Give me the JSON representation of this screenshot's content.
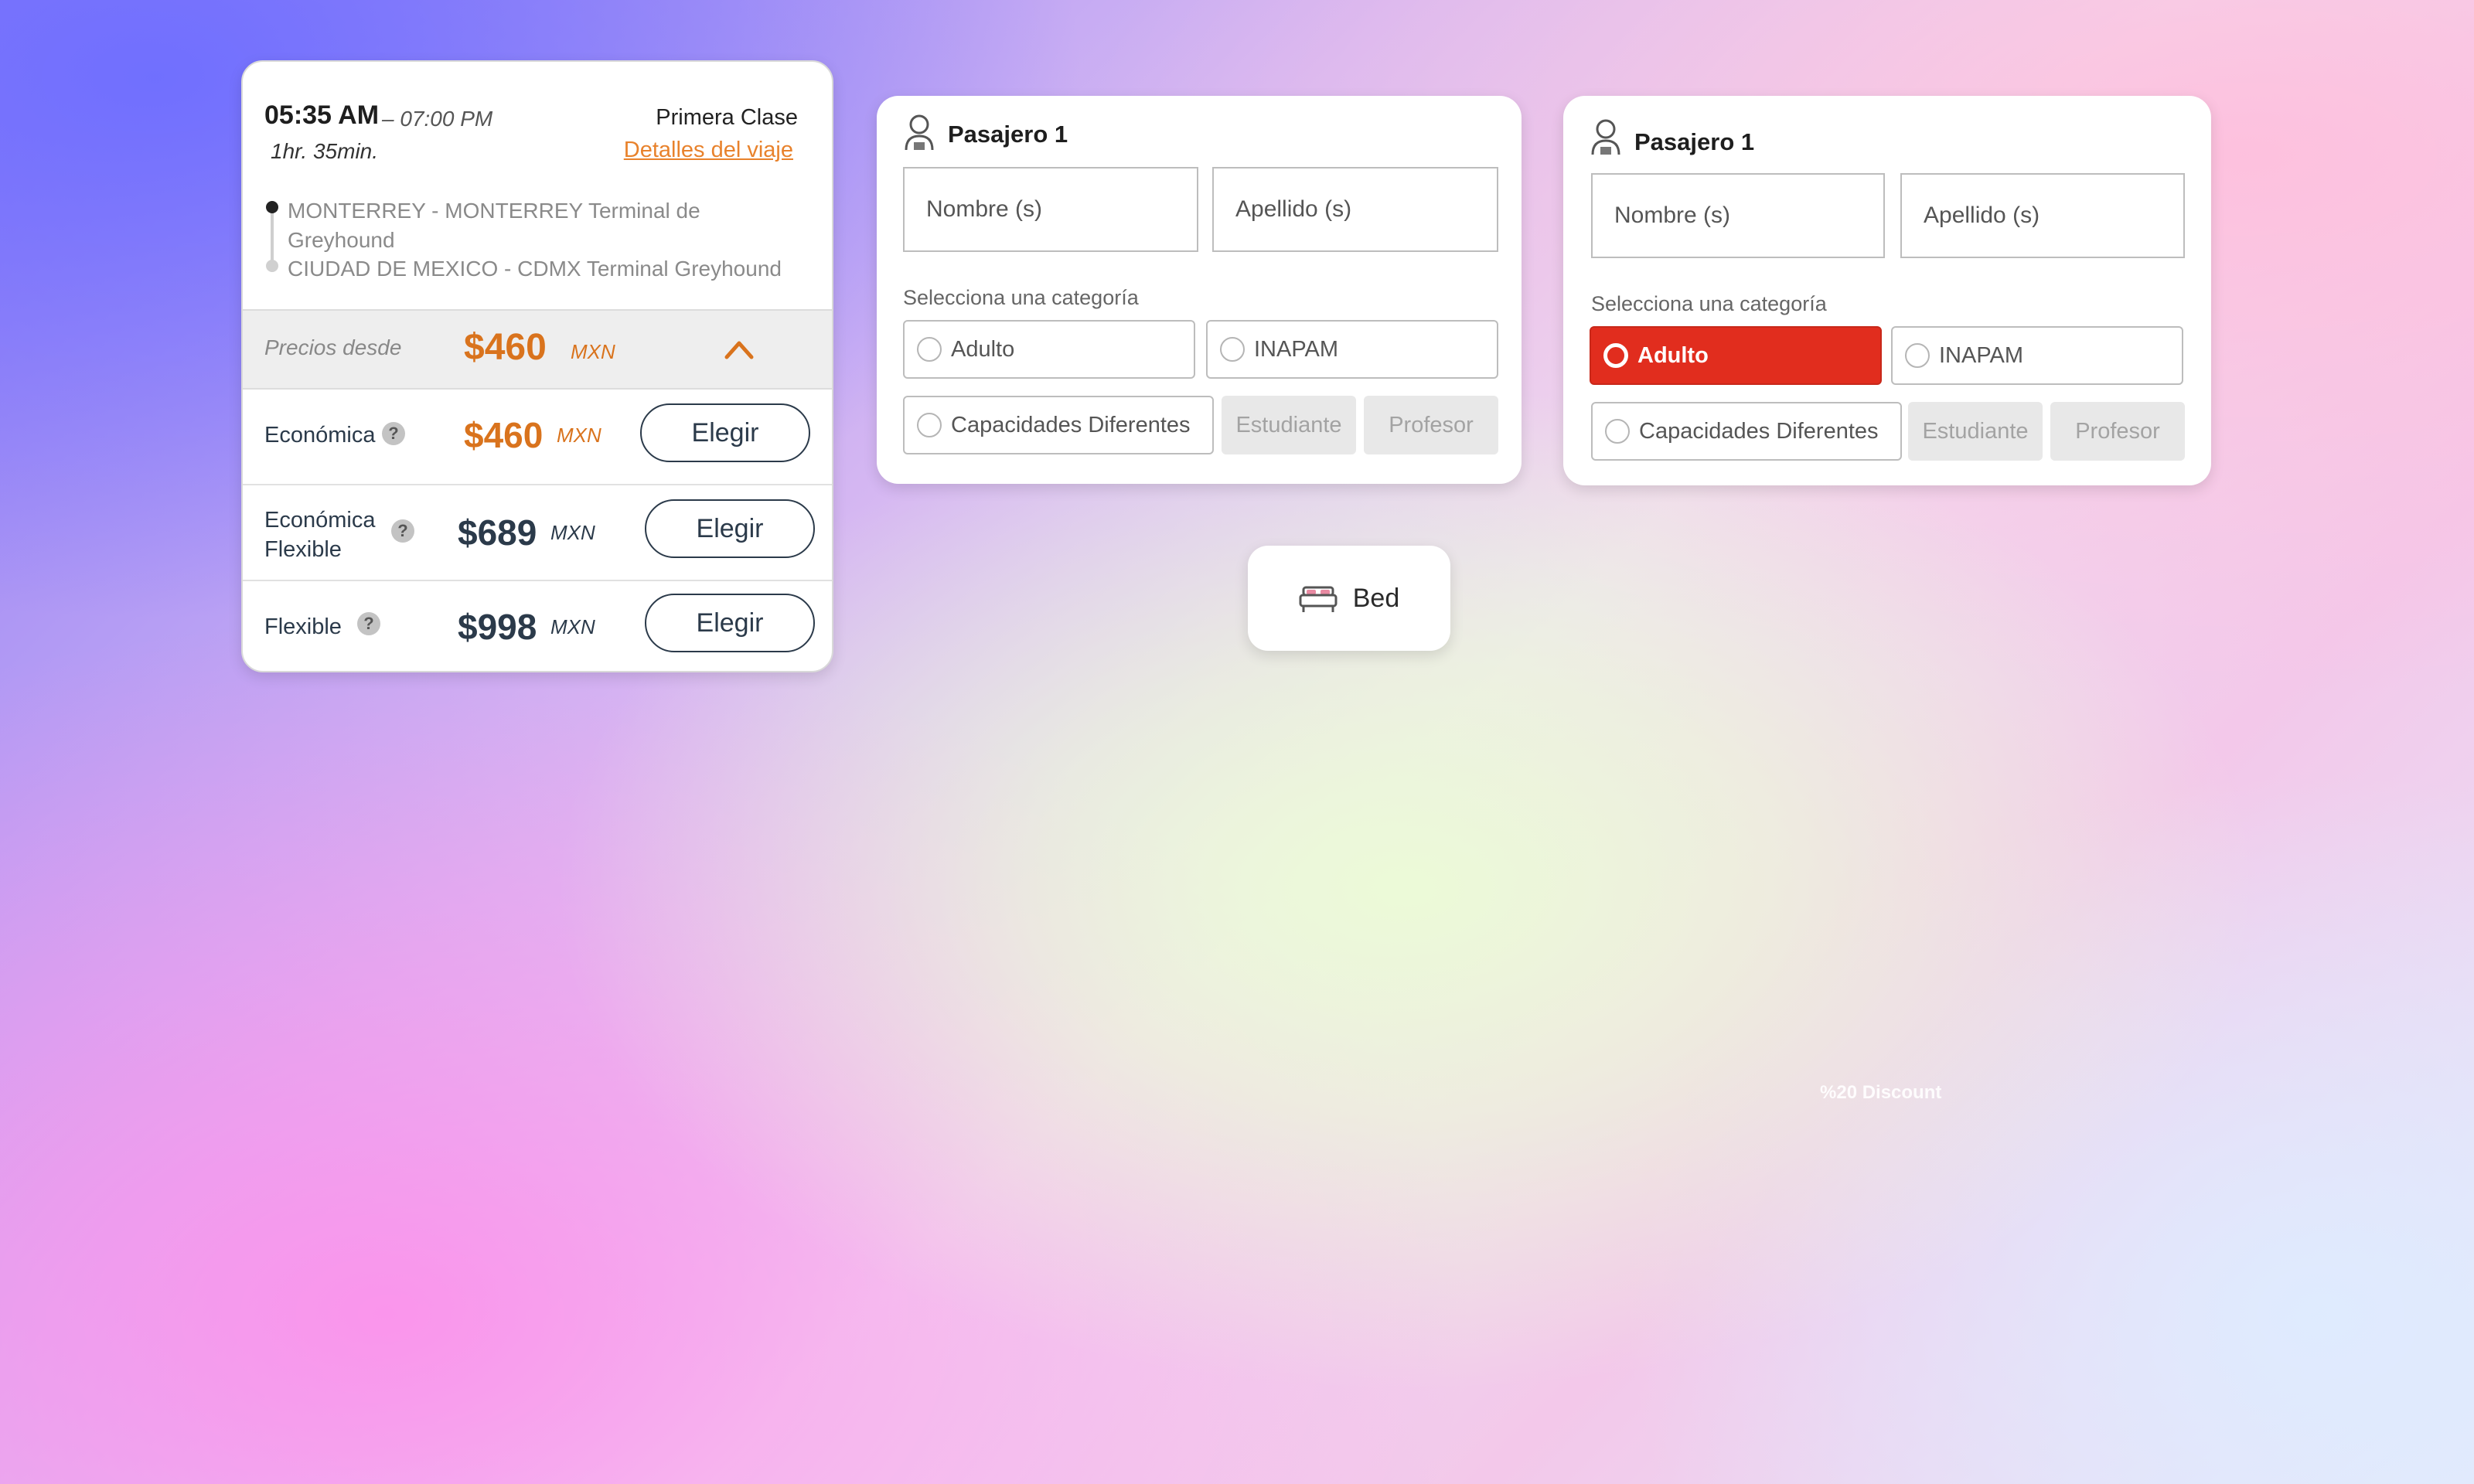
{
  "trip": {
    "departure_time": "05:35 AM",
    "arrival_time": "– 07:00 PM",
    "duration": "1hr. 35min.",
    "class_name": "Primera Clase",
    "details_link": "Detalles del viaje",
    "origin": "MONTERREY - MONTERREY Terminal de Greyhound",
    "destination": "CIUDAD DE MEXICO - CDMX Terminal Greyhound",
    "price_from_label": "Precios desde",
    "price_from": "$460",
    "price_from_currency": "MXN",
    "fares": [
      {
        "name": "Económica",
        "price": "$460",
        "currency": "MXN",
        "button": "Elegir"
      },
      {
        "name": "Económica Flexible",
        "price": "$689",
        "currency": "MXN",
        "button": "Elegir"
      },
      {
        "name": "Flexible",
        "price": "$998",
        "currency": "MXN",
        "button": "Elegir"
      }
    ],
    "help_glyph": "?"
  },
  "passenger_forms": [
    {
      "title": "Pasajero 1",
      "first_name_placeholder": "Nombre (s)",
      "last_name_placeholder": "Apellido (s)",
      "category_label": "Selecciona una categoría",
      "options": {
        "adult": "Adulto",
        "inapam": "INAPAM",
        "disabilities": "Capacidades Diferentes",
        "student": "Estudiante",
        "teacher": "Profesor"
      },
      "selected_option": null
    },
    {
      "title": "Pasajero 1",
      "first_name_placeholder": "Nombre (s)",
      "last_name_placeholder": "Apellido (s)",
      "category_label": "Selecciona una categoría",
      "options": {
        "adult": "Adulto",
        "inapam": "INAPAM",
        "disabilities": "Capacidades Diferentes",
        "student": "Estudiante",
        "teacher": "Profesor"
      },
      "selected_option": "Adulto"
    }
  ],
  "bed_chip": {
    "label": "Bed",
    "icon": "bed-icon"
  },
  "discount_text": "%20 Discount",
  "colors": {
    "accent_orange": "#d9731d",
    "selected_red": "#e12d1e",
    "text_dark": "#2b3a4a"
  }
}
